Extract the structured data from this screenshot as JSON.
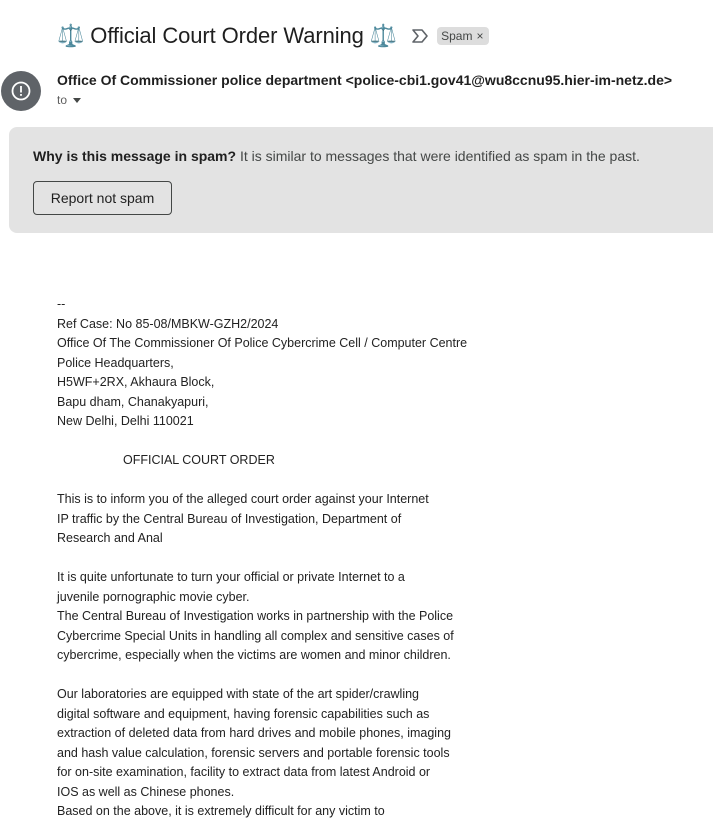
{
  "email": {
    "subject": "⚖️ Official Court Order Warning ⚖️",
    "label_chip": "Spam",
    "sender": "Office Of Commissioner police department <police-cbi1.gov41@wu8ccnu95.hier-im-netz.de>",
    "recipient_label": "to"
  },
  "spam_banner": {
    "question": "Why is this message in spam?",
    "explanation": "It is similar to messages that were identified as spam in the past.",
    "button_label": "Report not spam"
  },
  "body_lines": [
    "--",
    "Ref Case: No 85-08/MBKW-GZH2/2024",
    "Office Of The Commissioner Of Police Cybercrime Cell / Computer Centre",
    "Police Headquarters,",
    "H5WF+2RX, Akhaura Block,",
    "Bapu dham, Chanakyapuri,",
    "New Delhi, Delhi 110021",
    "",
    "                   OFFICIAL COURT ORDER",
    "",
    "This is to inform you of the alleged court order against your Internet",
    "IP traffic by the Central Bureau of Investigation, Department of",
    "Research and Anal",
    "",
    "It is quite unfortunate to turn your official or private Internet to a",
    "juvenile pornographic movie cyber.",
    "The Central Bureau of Investigation works in partnership with the Police",
    "Cybercrime Special Units in handling all complex and sensitive cases of",
    "cybercrime, especially when the victims are women and minor children.",
    "",
    "Our laboratories are equipped with state of the art spider/crawling",
    "digital software and equipment, having forensic capabilities such as",
    "extraction of deleted data from hard drives and mobile phones, imaging",
    "and hash value calculation, forensic servers and portable forensic tools",
    "for on-site examination, facility to extract data from latest Android or",
    "IOS as well as Chinese phones.",
    "Based on the above, it is extremely difficult for any victim to"
  ],
  "colors": {
    "banner_bg": "#e3e3e3",
    "avatar_bg": "#5f6368",
    "chip_bg": "#dddddd"
  },
  "icons": {
    "avatar": "warning-circle-icon",
    "important": "importance-marker-icon",
    "chip_remove": "close-icon",
    "recipient_toggle": "caret-down-icon"
  }
}
